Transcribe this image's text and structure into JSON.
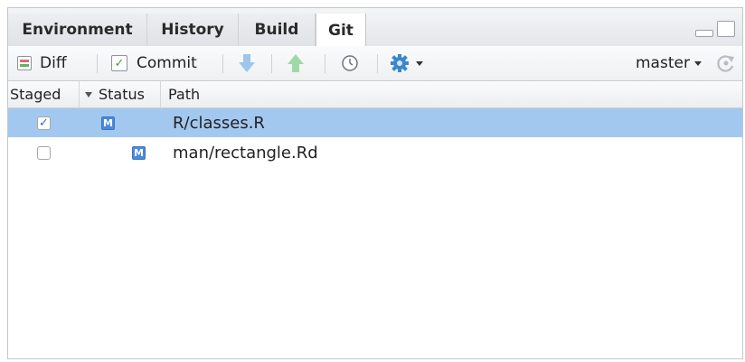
{
  "tabs": [
    {
      "label": "Environment",
      "active": false
    },
    {
      "label": "History",
      "active": false
    },
    {
      "label": "Build",
      "active": false
    },
    {
      "label": "Git",
      "active": true
    }
  ],
  "toolbar": {
    "diff_label": "Diff",
    "commit_label": "Commit",
    "pull_icon": "arrow-down-icon",
    "push_icon": "arrow-up-icon",
    "history_icon": "clock-icon",
    "more_icon": "gear-icon",
    "branch_label": "master",
    "refresh_icon": "refresh-icon"
  },
  "table": {
    "columns": [
      "Staged",
      "Status",
      "Path"
    ],
    "rows": [
      {
        "staged": true,
        "status": "M",
        "path": "R/classes.R",
        "selected": true
      },
      {
        "staged": false,
        "status": "M",
        "path": "man/rectangle.Rd",
        "selected": false
      }
    ]
  },
  "colors": {
    "selection": "#a3c8f0",
    "modified_badge": "#4a8ad8",
    "accent": "#2a6fc7"
  }
}
